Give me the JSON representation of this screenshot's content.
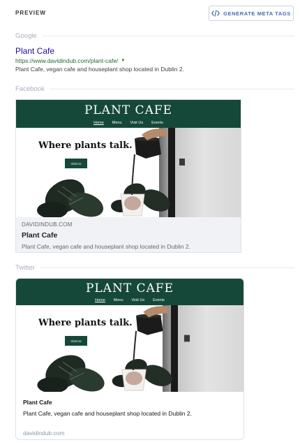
{
  "header": {
    "preview_label": "PREVIEW",
    "generate_button": "GENERATE META TAGS"
  },
  "sections": {
    "google": "Google",
    "facebook": "Facebook",
    "twitter": "Twitter"
  },
  "google": {
    "title": "Plant Cafe",
    "url": "https://www.davidindub.com/plant-cafe/",
    "description": "Plant Cafe, vegan cafe and houseplant shop located in Dublin 2."
  },
  "site_image": {
    "brand": "PLANT CAFE",
    "nav": [
      "Home",
      "Menu",
      "Visit Us",
      "Events"
    ],
    "tagline": "Where plants talk.",
    "cta": "Visit Us"
  },
  "facebook": {
    "domain": "DAVIDINDUB.COM",
    "title": "Plant Cafe",
    "description": "Plant Cafe, vegan cafe and houseplant shop located in Dublin 2."
  },
  "twitter": {
    "title": "Plant Cafe",
    "description": "Plant Cafe, vegan cafe and houseplant shop located in Dublin 2.",
    "domain": "davidindub.com"
  },
  "colors": {
    "brand_green": "#16483a",
    "google_link": "#1a0dab",
    "google_url": "#1e6b2e",
    "accent_blue": "#3f6db1"
  }
}
